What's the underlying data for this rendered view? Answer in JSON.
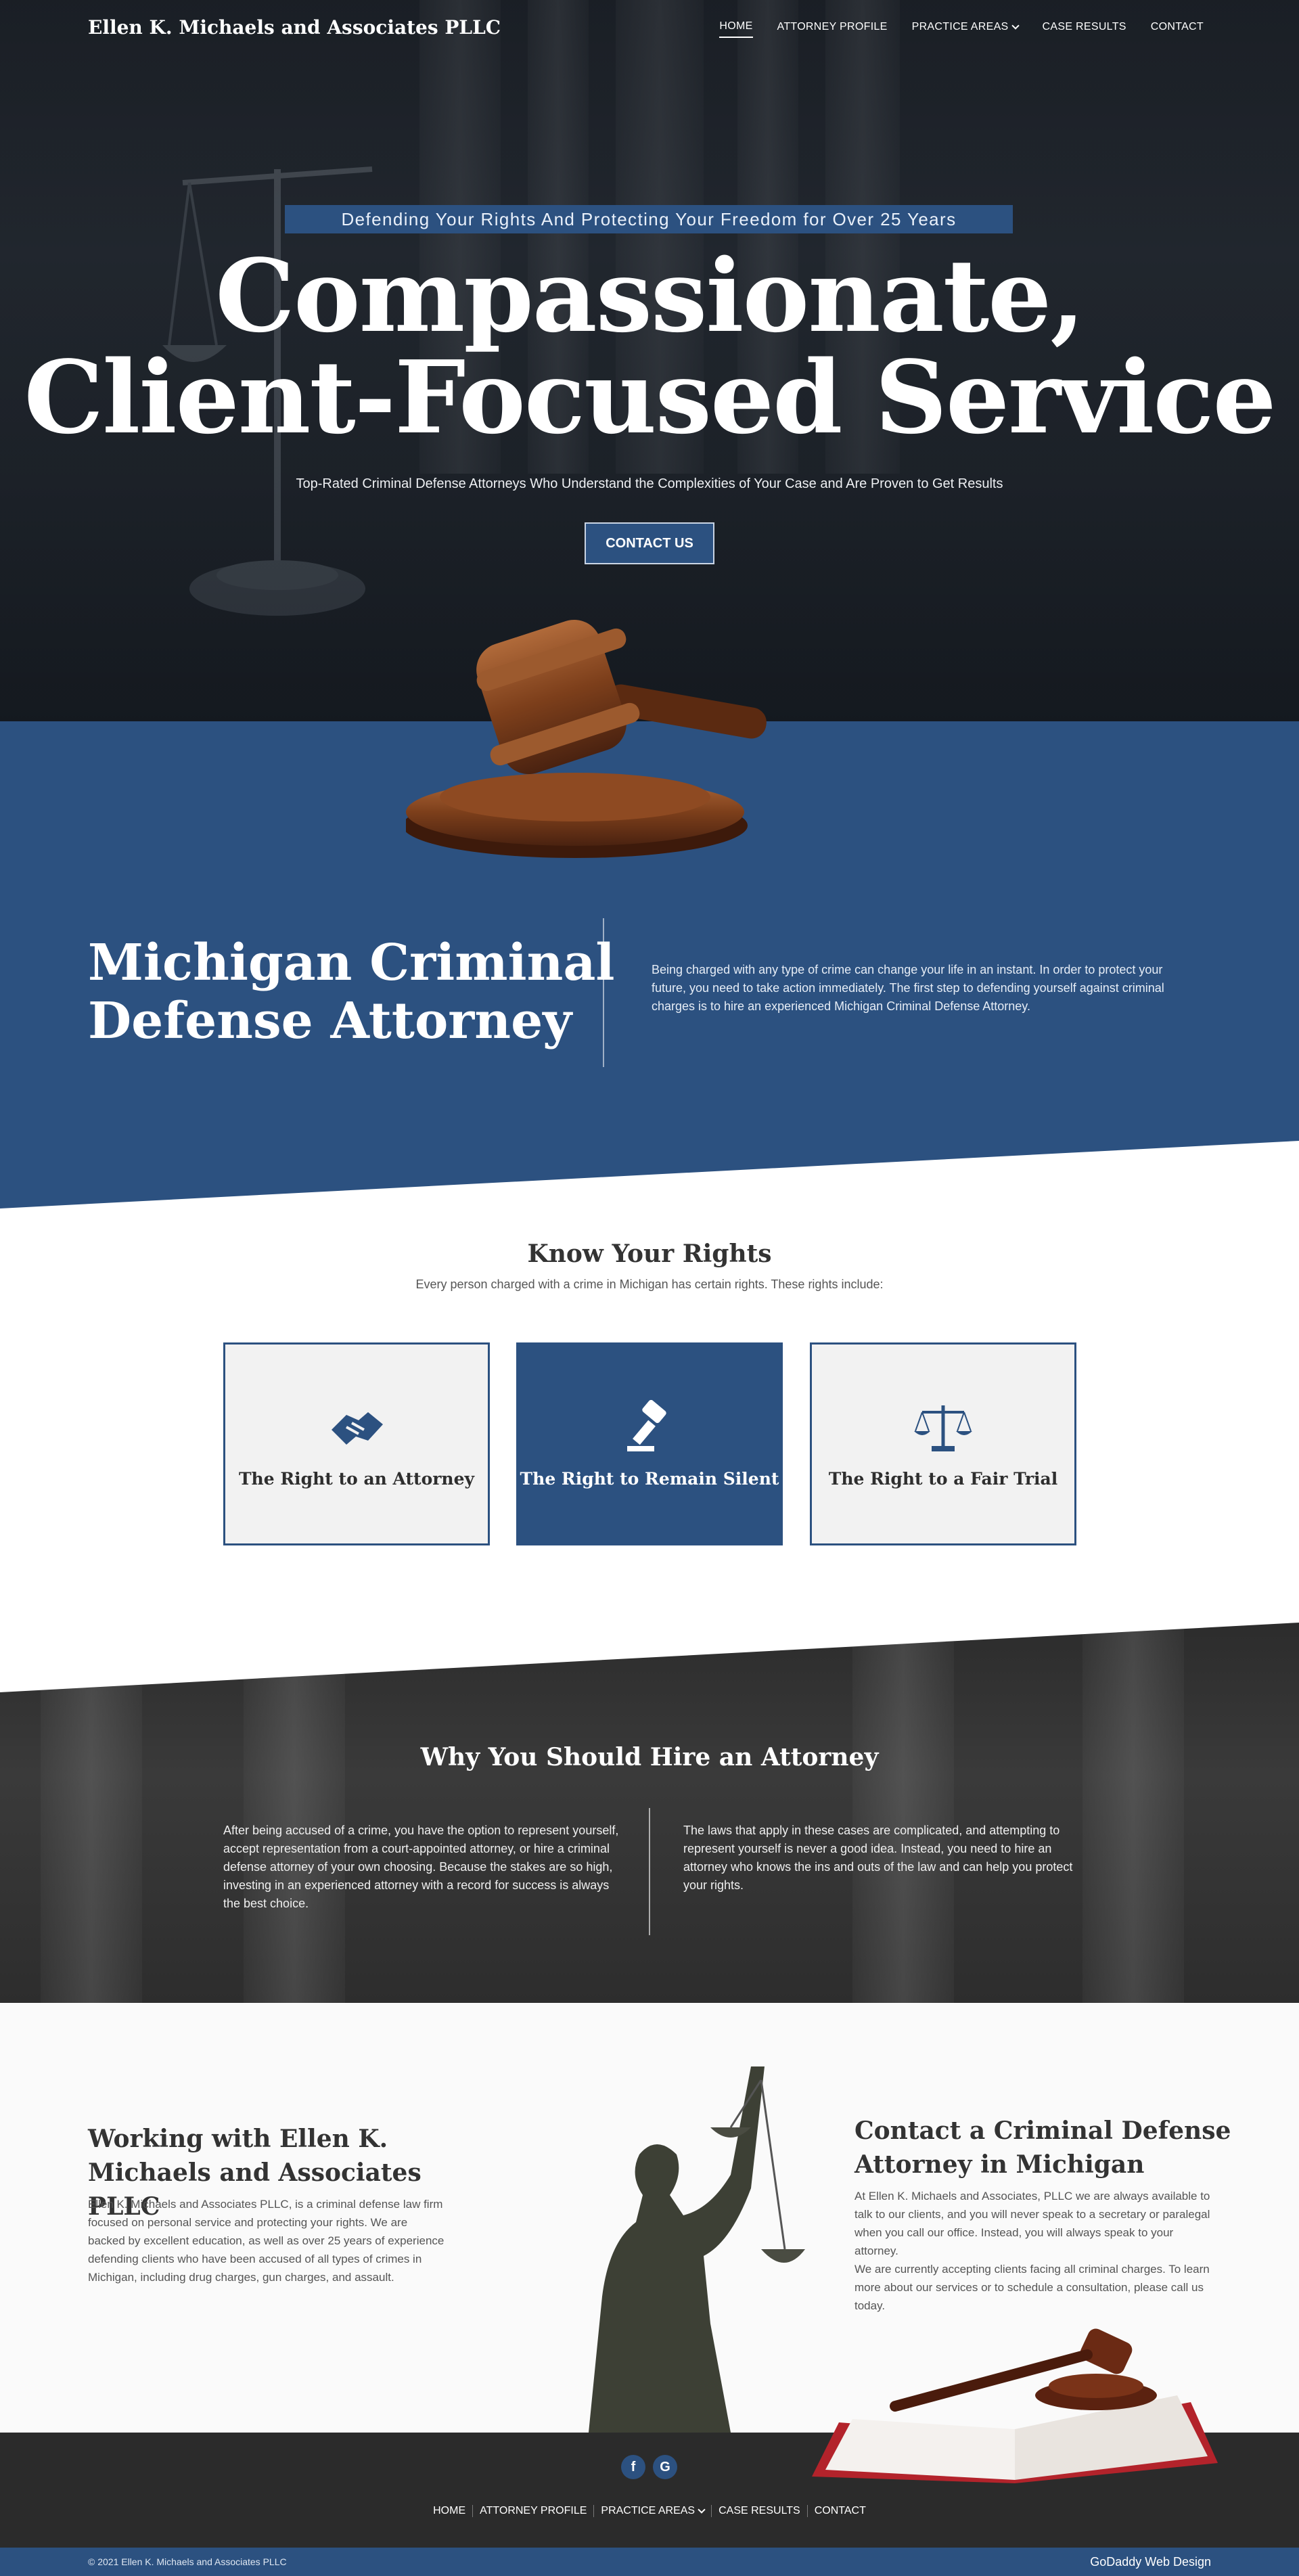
{
  "brand": "Ellen K. Michaels and Associates PLLC",
  "nav": {
    "items": [
      {
        "label": "HOME",
        "active": true
      },
      {
        "label": "ATTORNEY PROFILE"
      },
      {
        "label": "PRACTICE AREAS",
        "dropdown": true
      },
      {
        "label": "CASE RESULTS"
      },
      {
        "label": "CONTACT"
      }
    ]
  },
  "hero": {
    "tagline": "Defending Your Rights And Protecting Your Freedom for Over 25 Years",
    "title_line1": "Compassionate,",
    "title_line2": "Client-Focused Service",
    "subtitle": "Top-Rated Criminal Defense Attorneys Who Understand the Complexities of Your Case and Are Proven to Get Results",
    "button": "CONTACT US"
  },
  "intro": {
    "title_line1": "Michigan Criminal",
    "title_line2": "Defense Attorney",
    "text": "Being charged with any type of crime can change your life in an instant. In order to protect your future, you need to take action immediately. The first step to defending yourself against criminal charges is to hire an experienced Michigan Criminal Defense Attorney."
  },
  "rights": {
    "title": "Know Your Rights",
    "subtitle": "Every person charged with a crime in Michigan has certain rights. These rights include:",
    "cards": [
      {
        "label": "The Right to an Attorney",
        "icon": "handshake-icon"
      },
      {
        "label": "The Right to Remain Silent",
        "icon": "gavel-icon"
      },
      {
        "label": "The Right to a Fair Trial",
        "icon": "scales-icon"
      }
    ]
  },
  "why": {
    "title": "Why You Should Hire an Attorney",
    "left": "After being accused of a crime, you have the option to represent yourself, accept representation from a court-appointed attorney, or hire a criminal defense attorney of your own choosing. Because the stakes are so high, investing in an experienced attorney with a record for success is always the best choice.",
    "right": "The laws that apply in these cases are complicated, and attempting to represent yourself is never a good idea. Instead, you need to hire an attorney who knows the ins and outs of the law and can help you protect your rights."
  },
  "working": {
    "title": "Working with Ellen K. Michaels and Associates PLLC",
    "text": "Ellen K. Michaels and Associates PLLC, is a criminal defense law firm focused on personal service and protecting your rights. We are backed by excellent education, as well as over 25 years of experience defending clients who have been accused of all types of crimes in Michigan, including drug charges, gun charges, and assault."
  },
  "contact": {
    "title": "Contact a Criminal Defense Attorney in Michigan",
    "text1": "At Ellen K. Michaels and Associates, PLLC we are always available to talk to our clients, and you will never speak to a secretary or paralegal when you call our office. Instead, you will always speak to your attorney.",
    "text2": "We are currently accepting clients facing all criminal charges. To learn more about our services or to schedule a consultation, please call us today."
  },
  "footer": {
    "social": [
      {
        "name": "facebook-icon",
        "glyph": "f"
      },
      {
        "name": "google-icon",
        "glyph": "G"
      }
    ],
    "links": [
      {
        "label": "HOME"
      },
      {
        "label": "ATTORNEY PROFILE"
      },
      {
        "label": "PRACTICE AREAS",
        "dropdown": true
      },
      {
        "label": "CASE RESULTS"
      },
      {
        "label": "CONTACT"
      }
    ],
    "copyright": "© 2021 Ellen K. Michaels and Associates PLLC",
    "builder": "GoDaddy Web Design"
  },
  "colors": {
    "brand_blue": "#2c5180",
    "dark": "#2b2b2b"
  }
}
